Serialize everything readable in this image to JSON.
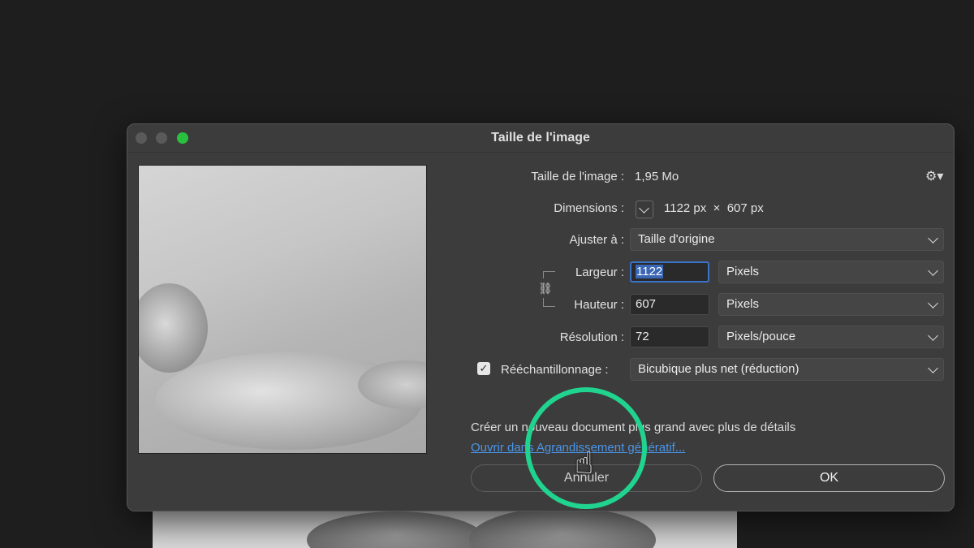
{
  "dialog": {
    "title": "Taille de l'image"
  },
  "image_size": {
    "label": "Taille de l'image :",
    "value": "1,95 Mo"
  },
  "dimensions": {
    "label": "Dimensions :",
    "value": "1122 px  ×  607 px"
  },
  "fit_to": {
    "label": "Ajuster à :",
    "selected": "Taille d'origine"
  },
  "width": {
    "label": "Largeur :",
    "value": "1122",
    "unit": "Pixels"
  },
  "height": {
    "label": "Hauteur :",
    "value": "607",
    "unit": "Pixels"
  },
  "resolution": {
    "label": "Résolution :",
    "value": "72",
    "unit": "Pixels/pouce"
  },
  "resample": {
    "label": "Rééchantillonnage :",
    "checked": true,
    "selected": "Bicubique plus net (réduction)"
  },
  "generative": {
    "info": "Créer un nouveau document plus grand avec plus de détails",
    "link": "Ouvrir dans Agrandissement génératif..."
  },
  "buttons": {
    "cancel": "Annuler",
    "ok": "OK"
  },
  "icons": {
    "gear": "gear-icon",
    "chain": "chain-link-icon",
    "check": "checkmark-icon",
    "cursor": "hand-pointer-icon"
  },
  "colors": {
    "accent_green": "#29c040",
    "focus_blue": "#3a73c9",
    "link_blue": "#4b95e8",
    "highlight_ring": "#20d48f"
  }
}
